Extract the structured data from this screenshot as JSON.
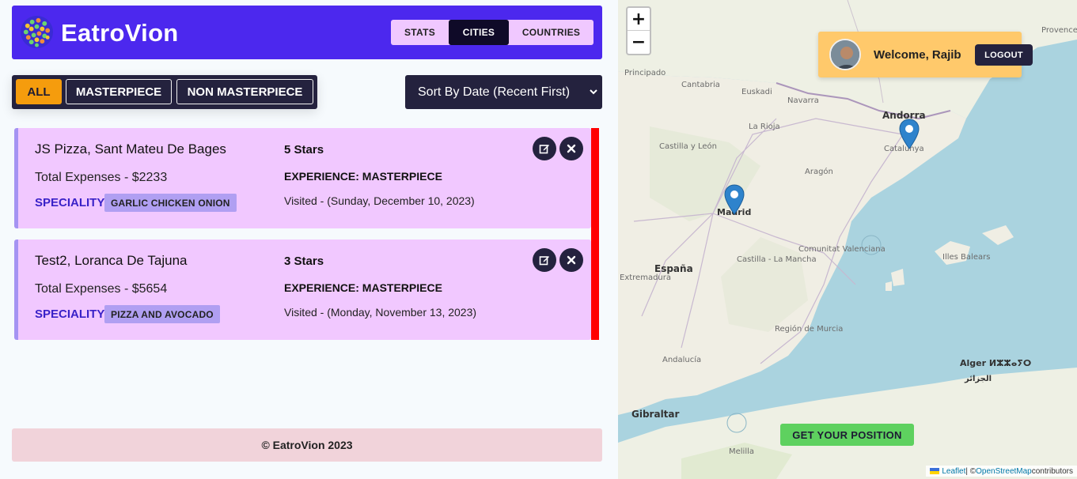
{
  "app": {
    "name": "EatroVion"
  },
  "nav": {
    "tabs": [
      "STATS",
      "CITIES",
      "COUNTRIES"
    ],
    "active": "CITIES"
  },
  "filters": {
    "all": "ALL",
    "masterpiece": "MASTERPIECE",
    "non_masterpiece": "NON MASTERPIECE",
    "active": "ALL"
  },
  "sort": {
    "selected": "Sort By Date (Recent First)"
  },
  "cities": [
    {
      "title": "JS Pizza, Sant Mateu De Bages",
      "expenses": "Total Expenses - $2233",
      "speciality_label": "SPECIALITY:",
      "speciality": "GARLIC CHICKEN ONION",
      "stars": "5 Stars",
      "experience": "EXPERIENCE: MASTERPIECE",
      "visited": "Visited - (Sunday, December 10, 2023)"
    },
    {
      "title": "Test2, Loranca De Tajuna",
      "expenses": "Total Expenses - $5654",
      "speciality_label": "SPECIALITY:",
      "speciality": "PIZZA AND AVOCADO",
      "stars": "3 Stars",
      "experience": "EXPERIENCE: MASTERPIECE",
      "visited": "Visited - (Monday, November 13, 2023)"
    }
  ],
  "footer": {
    "text": "© EatroVion 2023"
  },
  "map": {
    "zoom_in": "+",
    "zoom_out": "−",
    "welcome": "Welcome, Rajib",
    "logout": "LOGOUT",
    "get_position": "GET YOUR POSITION",
    "attribution": {
      "leaflet": "Leaflet",
      "sep": " | © ",
      "osm": "OpenStreetMap",
      "contrib": " contributors"
    },
    "labels": {
      "andorra": "Andorra",
      "catalunya": "Catalunya",
      "madrid": "Madrid",
      "espana": "España",
      "gibraltar": "Gibraltar",
      "alger": "Alger ⵍⵣⵣⴰⵢⵔ",
      "alger_ar": "الجزائر",
      "illes_balears": "Illes Balears",
      "castilla_leon": "Castilla y León",
      "castilla_mancha": "Castilla - La Mancha",
      "aragon": "Aragón",
      "la_rioja": "La Rioja",
      "euskadi": "Euskadi",
      "cantabria": "Cantabria",
      "navarra": "Navarra",
      "comunitat": "Comunitat Valenciana",
      "murcia": "Región de Murcia",
      "andalucia": "Andalucía",
      "extremadura": "Extremadura",
      "principado": "Principado",
      "melilla": "Melilla",
      "provence": "Provence"
    }
  },
  "colors": {
    "brand": "#4c28ee",
    "accent": "#f59c0d",
    "dark": "#24223e",
    "card": "#f1c8ff",
    "alert": "#ff0000",
    "success": "#5ed15f"
  }
}
